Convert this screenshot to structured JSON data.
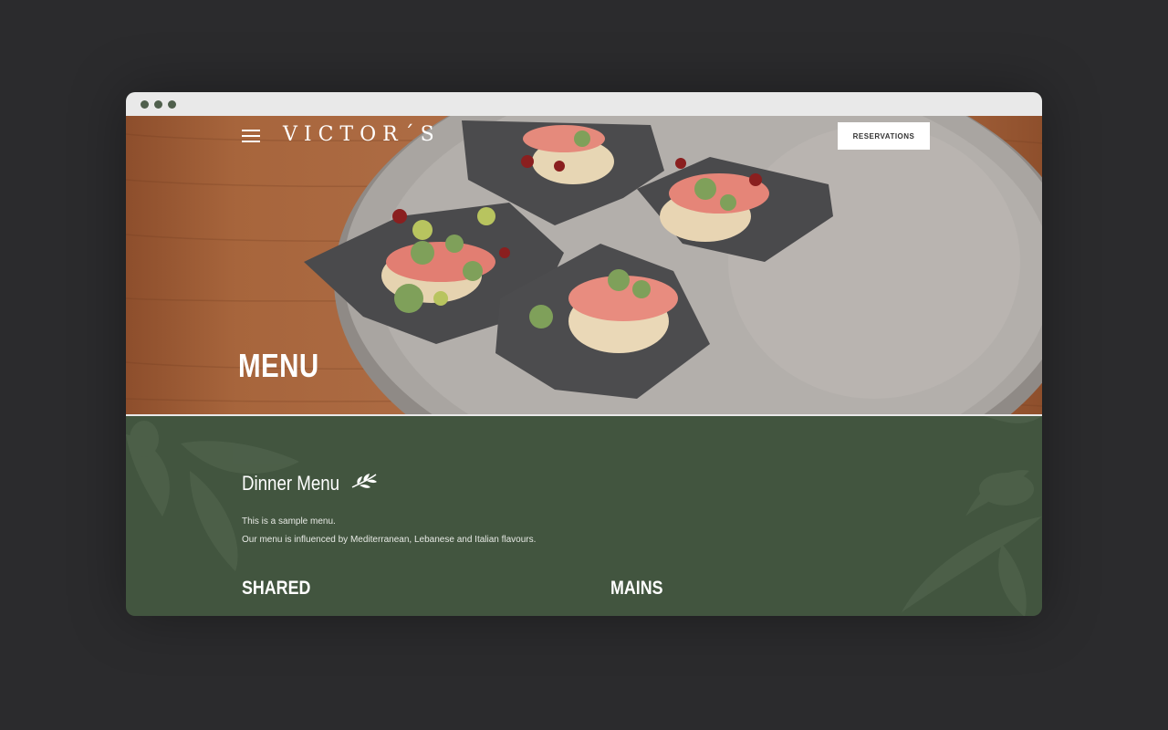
{
  "header": {
    "logo": "VICTOR´S",
    "reservations_label": "RESERVATIONS",
    "menu_icon": "hamburger-menu-icon"
  },
  "hero": {
    "title": "MENU",
    "image": "plated-appetizers-photo"
  },
  "dinner": {
    "title": "Dinner Menu",
    "title_icon": "olive-branch-icon",
    "description_line1": "This is a sample menu.",
    "description_line2": "Our menu is influenced by Mediterranean, Lebanese and Italian flavours."
  },
  "categories": [
    {
      "label": "SHARED"
    },
    {
      "label": "MAINS"
    }
  ],
  "colors": {
    "page_bg": "#2b2b2d",
    "brand_green": "#42553f",
    "titlebar": "#e9e9e9"
  }
}
